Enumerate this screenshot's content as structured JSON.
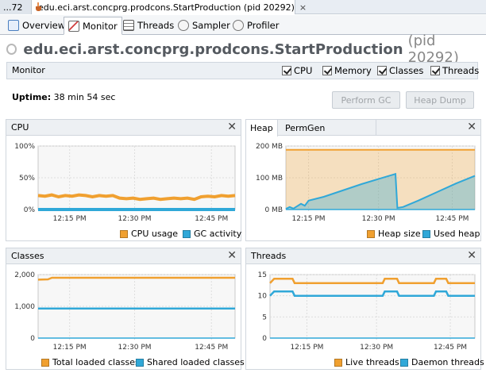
{
  "colors": {
    "orange": "#f0a030",
    "blue": "#30a8d8",
    "accent_border": "#b5bdc8"
  },
  "doc_tabs": {
    "overflow_label": "...72",
    "active_label": "edu.eci.arst.concprg.prodcons.StartProduction (pid 20292)",
    "close_glyph": "×"
  },
  "view_tabs": [
    {
      "label": "Overview",
      "icon": "overview-icon"
    },
    {
      "label": "Monitor",
      "icon": "monitor-icon"
    },
    {
      "label": "Threads",
      "icon": "threads-icon"
    },
    {
      "label": "Sampler",
      "icon": "sampler-icon"
    },
    {
      "label": "Profiler",
      "icon": "profiler-icon"
    }
  ],
  "title": {
    "main": "edu.eci.arst.concprg.prodcons.StartProduction",
    "pid": "(pid 20292)"
  },
  "monitor_bar": {
    "label": "Monitor",
    "checkboxes": [
      {
        "label": "CPU",
        "checked": true
      },
      {
        "label": "Memory",
        "checked": true
      },
      {
        "label": "Classes",
        "checked": true
      },
      {
        "label": "Threads",
        "checked": true
      }
    ]
  },
  "uptime": {
    "label": "Uptime:",
    "value": "38 min 54 sec"
  },
  "buttons": {
    "perform_gc": "Perform GC",
    "heap_dump": "Heap Dump"
  },
  "panels": {
    "cpu": {
      "title": "CPU",
      "y_ticks": [
        "100%",
        "50%",
        "0%"
      ],
      "x_ticks": [
        "12:15 PM",
        "12:30 PM",
        "12:45 PM"
      ],
      "legend": [
        "CPU usage",
        "GC activity"
      ]
    },
    "heap": {
      "tabs": [
        "Heap",
        "PermGen"
      ],
      "y_ticks": [
        "200 MB",
        "100 MB",
        "0 MB"
      ],
      "x_ticks": [
        "12:15 PM",
        "12:30 PM",
        "12:45 PM"
      ],
      "legend": [
        "Heap size",
        "Used heap"
      ]
    },
    "classes": {
      "title": "Classes",
      "y_ticks": [
        "2,000",
        "1,000",
        "0"
      ],
      "x_ticks": [
        "12:15 PM",
        "12:30 PM",
        "12:45 PM"
      ],
      "legend": [
        "Total loaded classes",
        "Shared loaded classes"
      ]
    },
    "threads": {
      "title": "Threads",
      "y_ticks": [
        "15",
        "10",
        "5",
        "0"
      ],
      "x_ticks": [
        "12:15 PM",
        "12:30 PM",
        "12:45 PM"
      ],
      "legend": [
        "Live threads",
        "Daemon threads"
      ]
    }
  },
  "chart_data": [
    {
      "type": "line",
      "title": "CPU",
      "ylim": [
        0,
        100
      ],
      "y_unit": "%",
      "x_ticks": [
        "12:15 PM",
        "12:30 PM",
        "12:45 PM"
      ],
      "series": [
        {
          "name": "CPU usage",
          "color": "#f0a030",
          "values": [
            22,
            21,
            23,
            20,
            22,
            21,
            23,
            22,
            20,
            22,
            21,
            22,
            18,
            17,
            18,
            16,
            17,
            18,
            16,
            17,
            18,
            17,
            18,
            16,
            20,
            21,
            20,
            22,
            21,
            22
          ]
        },
        {
          "name": "GC activity",
          "color": "#30a8d8",
          "values": [
            0,
            0,
            0,
            0,
            0,
            0,
            0,
            0,
            0,
            0,
            0,
            0,
            0,
            0,
            0,
            0,
            0,
            0,
            0,
            0,
            0,
            0,
            0,
            0,
            0,
            0,
            0,
            0,
            0,
            0
          ]
        }
      ]
    },
    {
      "type": "area",
      "title": "Heap",
      "ylim": [
        0,
        200
      ],
      "y_unit": "MB",
      "x_ticks": [
        "12:15 PM",
        "12:30 PM",
        "12:45 PM"
      ],
      "series": [
        {
          "name": "Heap size",
          "color": "#f0a030",
          "points": [
            [
              0,
              188
            ],
            [
              1,
              188
            ]
          ]
        },
        {
          "name": "Used heap",
          "color": "#30a8d8",
          "points": [
            [
              0,
              2
            ],
            [
              0.02,
              8
            ],
            [
              0.04,
              3
            ],
            [
              0.08,
              18
            ],
            [
              0.1,
              12
            ],
            [
              0.12,
              28
            ],
            [
              0.2,
              40
            ],
            [
              0.3,
              60
            ],
            [
              0.4,
              80
            ],
            [
              0.5,
              98
            ],
            [
              0.58,
              112
            ],
            [
              0.59,
              5
            ],
            [
              0.62,
              8
            ],
            [
              0.7,
              28
            ],
            [
              0.8,
              55
            ],
            [
              0.9,
              82
            ],
            [
              1,
              106
            ]
          ]
        }
      ]
    },
    {
      "type": "line",
      "title": "Classes",
      "ylim": [
        0,
        2000
      ],
      "x_ticks": [
        "12:15 PM",
        "12:30 PM",
        "12:45 PM"
      ],
      "series": [
        {
          "name": "Total loaded classes",
          "color": "#f0a030",
          "points": [
            [
              0,
              1840
            ],
            [
              0.05,
              1850
            ],
            [
              0.07,
              1900
            ],
            [
              1,
              1900
            ]
          ]
        },
        {
          "name": "Shared loaded classes",
          "color": "#30a8d8",
          "points": [
            [
              0,
              930
            ],
            [
              1,
              930
            ]
          ]
        }
      ]
    },
    {
      "type": "line",
      "title": "Threads",
      "ylim": [
        0,
        15
      ],
      "x_ticks": [
        "12:15 PM",
        "12:30 PM",
        "12:45 PM"
      ],
      "series": [
        {
          "name": "Live threads",
          "color": "#f0a030",
          "points": [
            [
              0,
              13
            ],
            [
              0.02,
              14
            ],
            [
              0.11,
              14
            ],
            [
              0.12,
              13
            ],
            [
              0.55,
              13
            ],
            [
              0.56,
              14
            ],
            [
              0.62,
              14
            ],
            [
              0.63,
              13
            ],
            [
              0.8,
              13
            ],
            [
              0.81,
              14
            ],
            [
              0.86,
              14
            ],
            [
              0.87,
              13
            ],
            [
              1,
              13
            ]
          ]
        },
        {
          "name": "Daemon threads",
          "color": "#30a8d8",
          "points": [
            [
              0,
              10
            ],
            [
              0.02,
              11
            ],
            [
              0.11,
              11
            ],
            [
              0.12,
              10
            ],
            [
              0.55,
              10
            ],
            [
              0.56,
              11
            ],
            [
              0.62,
              11
            ],
            [
              0.63,
              10
            ],
            [
              0.8,
              10
            ],
            [
              0.81,
              11
            ],
            [
              0.86,
              11
            ],
            [
              0.87,
              10
            ],
            [
              1,
              10
            ]
          ]
        }
      ]
    }
  ]
}
